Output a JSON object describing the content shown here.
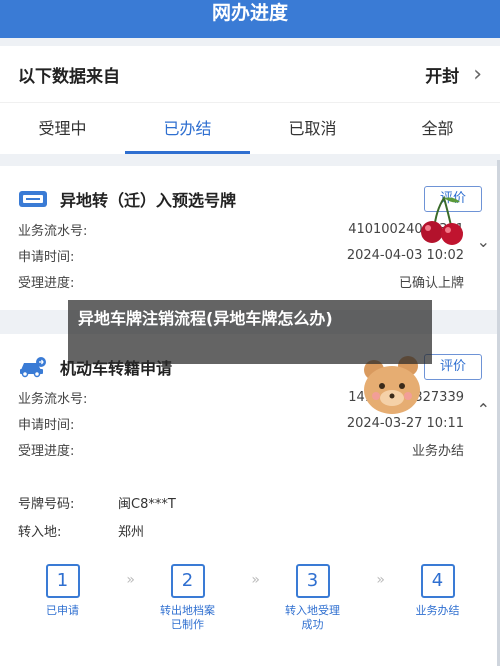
{
  "topbar": {
    "title": "网办进度"
  },
  "source": {
    "label": "以下数据来自",
    "province": "开封",
    "chevron": "›"
  },
  "tabs": [
    {
      "label": "受理中",
      "active": false
    },
    {
      "label": "已办结",
      "active": true
    },
    {
      "label": "已取消",
      "active": false
    },
    {
      "label": "全部",
      "active": false
    }
  ],
  "card1": {
    "icon": "license-plate-icon",
    "title": "异地转（迁）入预选号牌",
    "rate_label": "评价",
    "rows": [
      {
        "k": "业务流水号:",
        "v": "41010024040311"
      },
      {
        "k": "申请时间:",
        "v": "2024-04-03 10:02"
      },
      {
        "k": "受理进度:",
        "v": "已确认上牌"
      }
    ]
  },
  "overlay": {
    "text": "异地车牌注销流程(异地车牌怎么办)"
  },
  "card2": {
    "icon": "vehicle-transfer-icon",
    "title": "机动车转籍申请",
    "rate_label": "评价",
    "rows": [
      {
        "k": "业务流水号:",
        "v": "14100240327339"
      },
      {
        "k": "申请时间:",
        "v": "2024-03-27 10:11"
      },
      {
        "k": "受理进度:",
        "v": "业务办结"
      }
    ],
    "plate_label": "号牌号码:",
    "plate_value": "闽C8***T",
    "dest_label": "转入地:",
    "dest_value": "郑州",
    "steps": [
      {
        "num": "1",
        "line1": "已申请",
        "line2": ""
      },
      {
        "num": "2",
        "line1": "转出地档案",
        "line2": "已制作"
      },
      {
        "num": "3",
        "line1": "转入地受理",
        "line2": "成功"
      },
      {
        "num": "4",
        "line1": "业务办结",
        "line2": ""
      }
    ]
  },
  "colors": {
    "accent": "#2f6fd0",
    "topbar": "#3a7bd5"
  }
}
